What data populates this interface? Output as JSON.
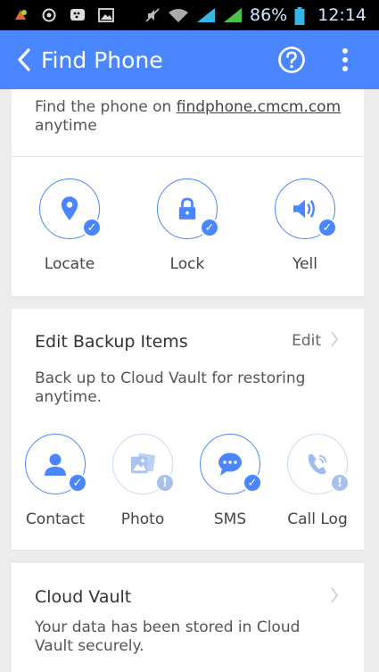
{
  "status_bar": {
    "battery": "86%",
    "time": "12:14",
    "icons": [
      "notification-icon",
      "circle-icon",
      "bbm-icon",
      "image-icon",
      "mute-icon",
      "wifi-icon",
      "signal-icon",
      "signal-icon-2",
      "battery-icon"
    ]
  },
  "appbar": {
    "title": "Find Phone",
    "background": "#4a86ff"
  },
  "find_card": {
    "desc_prefix": "Find the phone on ",
    "link": "findphone.cmcm.com",
    "desc_suffix": "anytime",
    "features": [
      {
        "label": "Locate",
        "icon": "location-pin-icon",
        "badge": "check"
      },
      {
        "label": "Lock",
        "icon": "lock-icon",
        "badge": "check"
      },
      {
        "label": "Yell",
        "icon": "speaker-icon",
        "badge": "check"
      }
    ]
  },
  "backup_card": {
    "title": "Edit Backup Items",
    "edit_label": "Edit",
    "desc": "Back up to Cloud Vault for restoring anytime.",
    "items": [
      {
        "label": "Contact",
        "icon": "contact-icon",
        "badge": "check"
      },
      {
        "label": "Photo",
        "icon": "photo-icon",
        "badge": "warning"
      },
      {
        "label": "SMS",
        "icon": "sms-icon",
        "badge": "check"
      },
      {
        "label": "Call Log",
        "icon": "call-log-icon",
        "badge": "warning"
      }
    ]
  },
  "vault_card": {
    "title": "Cloud Vault",
    "desc": "Your data has been stored in Cloud Vault securely."
  }
}
